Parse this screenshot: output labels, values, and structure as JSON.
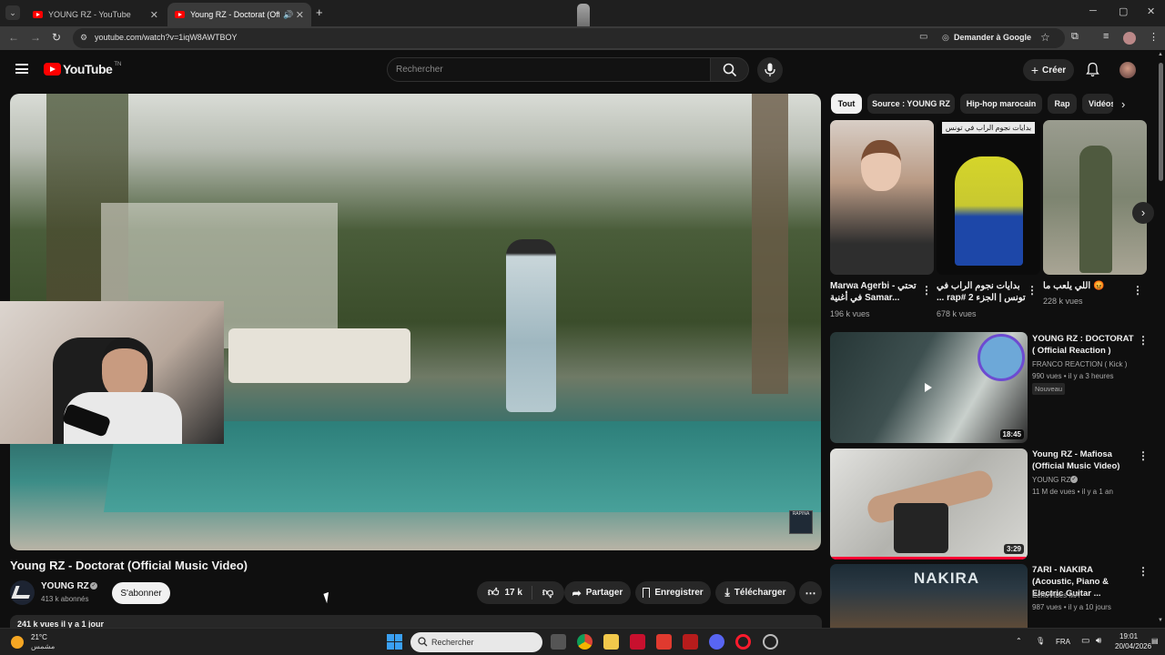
{
  "browser": {
    "tabs": [
      {
        "title": "YOUNG RZ - YouTube",
        "active": false
      },
      {
        "title": "Young RZ - Doctorat (Offici",
        "active": true
      }
    ],
    "url": "youtube.com/watch?v=1iqW8AWTBOY",
    "ask_google": "Demander à Google"
  },
  "youtube": {
    "logo_text": "YouTube",
    "logo_region": "TN",
    "search_placeholder": "Rechercher",
    "create_label": "Créer"
  },
  "video": {
    "title": "Young RZ - Doctorat (Official Music Video)",
    "channel": "YOUNG RZ",
    "subscribers": "413 k abonnés",
    "subscribe_label": "S'abonner",
    "likes": "17 k",
    "share_label": "Partager",
    "save_label": "Enregistrer",
    "download_label": "Télécharger",
    "description_stats": "241 k vues  il y a 1 jour",
    "watermark": "RAPINA"
  },
  "chips": [
    "Tout",
    "Source : YOUNG RZ",
    "Hip-hop marocain",
    "Rap",
    "Vidéos"
  ],
  "shorts": [
    {
      "title": "Marwa Agerbi - تحتي في أغنية Samar...",
      "views": "196 k vues",
      "colors": [
        "#cfc4bb",
        "#8a6a55",
        "#2a2a2a"
      ]
    },
    {
      "title": "بدايات نجوم الراب في تونس | الجزء 2 #rap ...",
      "views": "678 k vues",
      "overlay_text": "بدايات نجوم الراب في تونس",
      "colors": [
        "#0b0b0b",
        "#e5e52e",
        "#1a3f9a"
      ]
    },
    {
      "title": "😡 اللي يلعب ما يخترش",
      "views": "228 k vues",
      "colors": [
        "#8c8f80",
        "#5d6a4c",
        "#3f4a35"
      ]
    }
  ],
  "recommendations": [
    {
      "title": "YOUNG RZ : DOCTORAT ( Official Reaction )",
      "channel": "FRANCO REACTION ( Kick )",
      "meta": "990 vues • il y a 3 heures",
      "badge": "Nouveau",
      "duration": "18:45",
      "colors": [
        "#2c3a3a",
        "#c8cfcc",
        "#1a1a1a"
      ]
    },
    {
      "title": "Young RZ - Mafiosa (Official Music Video)",
      "channel": "YOUNG RZ",
      "meta": "11 M de vues • il y a 1 an",
      "badge": "",
      "duration": "3:29",
      "colors": [
        "#d9d9d5",
        "#9a9a95",
        "#2a2a2a"
      ]
    },
    {
      "title": "7ARI - NAKIRA (Acoustic, Piano & Electric Guitar ...",
      "channel": "EchoVibes MA",
      "meta": "987 vues • il y a 10 jours",
      "badge": "",
      "duration": "",
      "thumb_text": "NAKIRA",
      "colors": [
        "#1b2a33",
        "#5c4a3a",
        "#101418"
      ]
    }
  ],
  "taskbar": {
    "weather_temp": "21°C",
    "weather_desc": "مشمس",
    "search_placeholder": "Rechercher",
    "lang": "FRA",
    "time": "19:01",
    "date": "20/04/2026"
  }
}
